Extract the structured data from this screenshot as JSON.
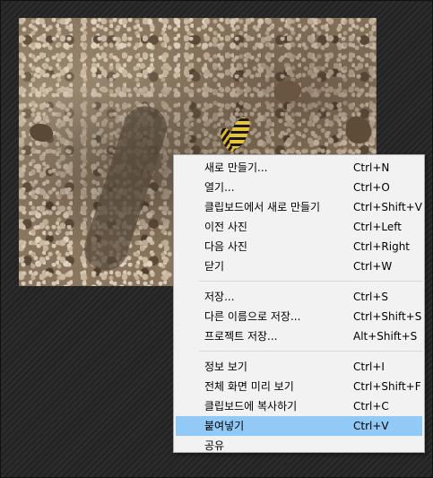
{
  "menu": {
    "groups": [
      [
        {
          "label": "새로 만들기...",
          "shortcut": "Ctrl+N"
        },
        {
          "label": "열기...",
          "shortcut": "Ctrl+O"
        },
        {
          "label": "클립보드에서 새로 만들기",
          "shortcut": "Ctrl+Shift+V"
        },
        {
          "label": "이전 사진",
          "shortcut": "Ctrl+Left"
        },
        {
          "label": "다음 사진",
          "shortcut": "Ctrl+Right"
        },
        {
          "label": "닫기",
          "shortcut": "Ctrl+W"
        }
      ],
      [
        {
          "label": "저장...",
          "shortcut": "Ctrl+S"
        },
        {
          "label": "다른 이름으로 저장...",
          "shortcut": "Ctrl+Shift+S"
        },
        {
          "label": "프로젝트 저장...",
          "shortcut": "Alt+Shift+S"
        }
      ],
      [
        {
          "label": "정보 보기",
          "shortcut": "Ctrl+I"
        },
        {
          "label": "전체 화면 미리 보기",
          "shortcut": "Ctrl+Shift+F"
        },
        {
          "label": "클립보드에 복사하기",
          "shortcut": "Ctrl+C"
        },
        {
          "label": "붙여넣기",
          "shortcut": "Ctrl+V",
          "highlighted": true
        },
        {
          "label": "공유",
          "shortcut": ""
        }
      ]
    ],
    "highlight_color": "#91c9f7"
  },
  "photo": {
    "subject": "swallowtail butterfly on gravel ground"
  }
}
